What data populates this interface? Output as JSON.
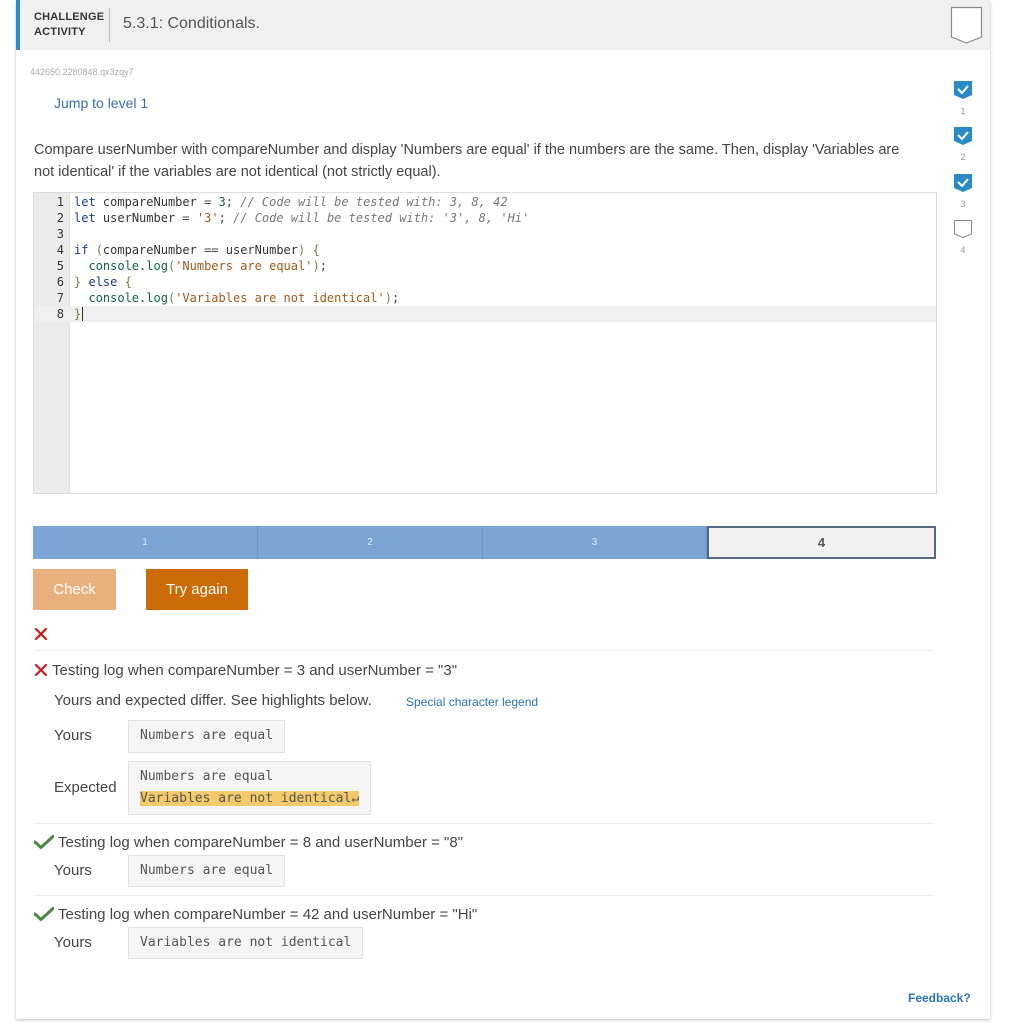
{
  "header": {
    "label_line1": "CHALLENGE",
    "label_line2": "ACTIVITY",
    "title": "5.3.1: Conditionals."
  },
  "activity_id": "442650.2280848.qx3zqy7",
  "jump_link": "Jump to level 1",
  "prompt": "Compare userNumber with compareNumber and display 'Numbers are equal' if the numbers are the same. Then, display 'Variables are not identical' if the variables are not identical (not strictly equal).",
  "code_lines": [
    {
      "n": "1"
    },
    {
      "n": "2"
    },
    {
      "n": "3"
    },
    {
      "n": "4"
    },
    {
      "n": "5"
    },
    {
      "n": "6"
    },
    {
      "n": "7"
    },
    {
      "n": "8"
    }
  ],
  "code_text": [
    "let compareNumber = 3; // Code will be tested with: 3, 8, 42",
    "let userNumber = '3'; // Code will be tested with: '3', 8, 'Hi'",
    "",
    "if (compareNumber == userNumber) {",
    "  console.log('Numbers are equal');",
    "} else {",
    "  console.log('Variables are not identical');",
    "}"
  ],
  "progress": {
    "segments": [
      "1",
      "2",
      "3",
      "4"
    ],
    "current": "4"
  },
  "buttons": {
    "check": "Check",
    "try_again": "Try again"
  },
  "tests": [
    {
      "status": "fail",
      "title": "Testing log when compareNumber = 3 and userNumber = \"3\"",
      "note": "Yours and expected differ. See highlights below.",
      "legend": "Special character legend",
      "yours_label": "Yours",
      "yours": "Numbers are equal",
      "expected_label": "Expected",
      "expected_line1": "Numbers are equal",
      "expected_line2": "Variables are not identical↵"
    },
    {
      "status": "pass",
      "title": "Testing log when compareNumber = 8 and userNumber = \"8\"",
      "yours_label": "Yours",
      "yours": "Numbers are equal"
    },
    {
      "status": "pass",
      "title": "Testing log when compareNumber = 42 and userNumber = \"Hi\"",
      "yours_label": "Yours",
      "yours": "Variables are not identical"
    }
  ],
  "levels": [
    {
      "label": "1",
      "completed": true
    },
    {
      "label": "2",
      "completed": true
    },
    {
      "label": "3",
      "completed": true
    },
    {
      "label": "4",
      "completed": false
    }
  ],
  "feedback": "Feedback?",
  "colors": {
    "accent_blue": "#2a8ac6",
    "progress_done": "#7ba5d3",
    "try_again": "#cc6a06",
    "check_disabled": "#e8b07d",
    "fail_red": "#cc1a1a",
    "pass_green": "#4a8a3a",
    "highlight": "#f4c96a"
  }
}
